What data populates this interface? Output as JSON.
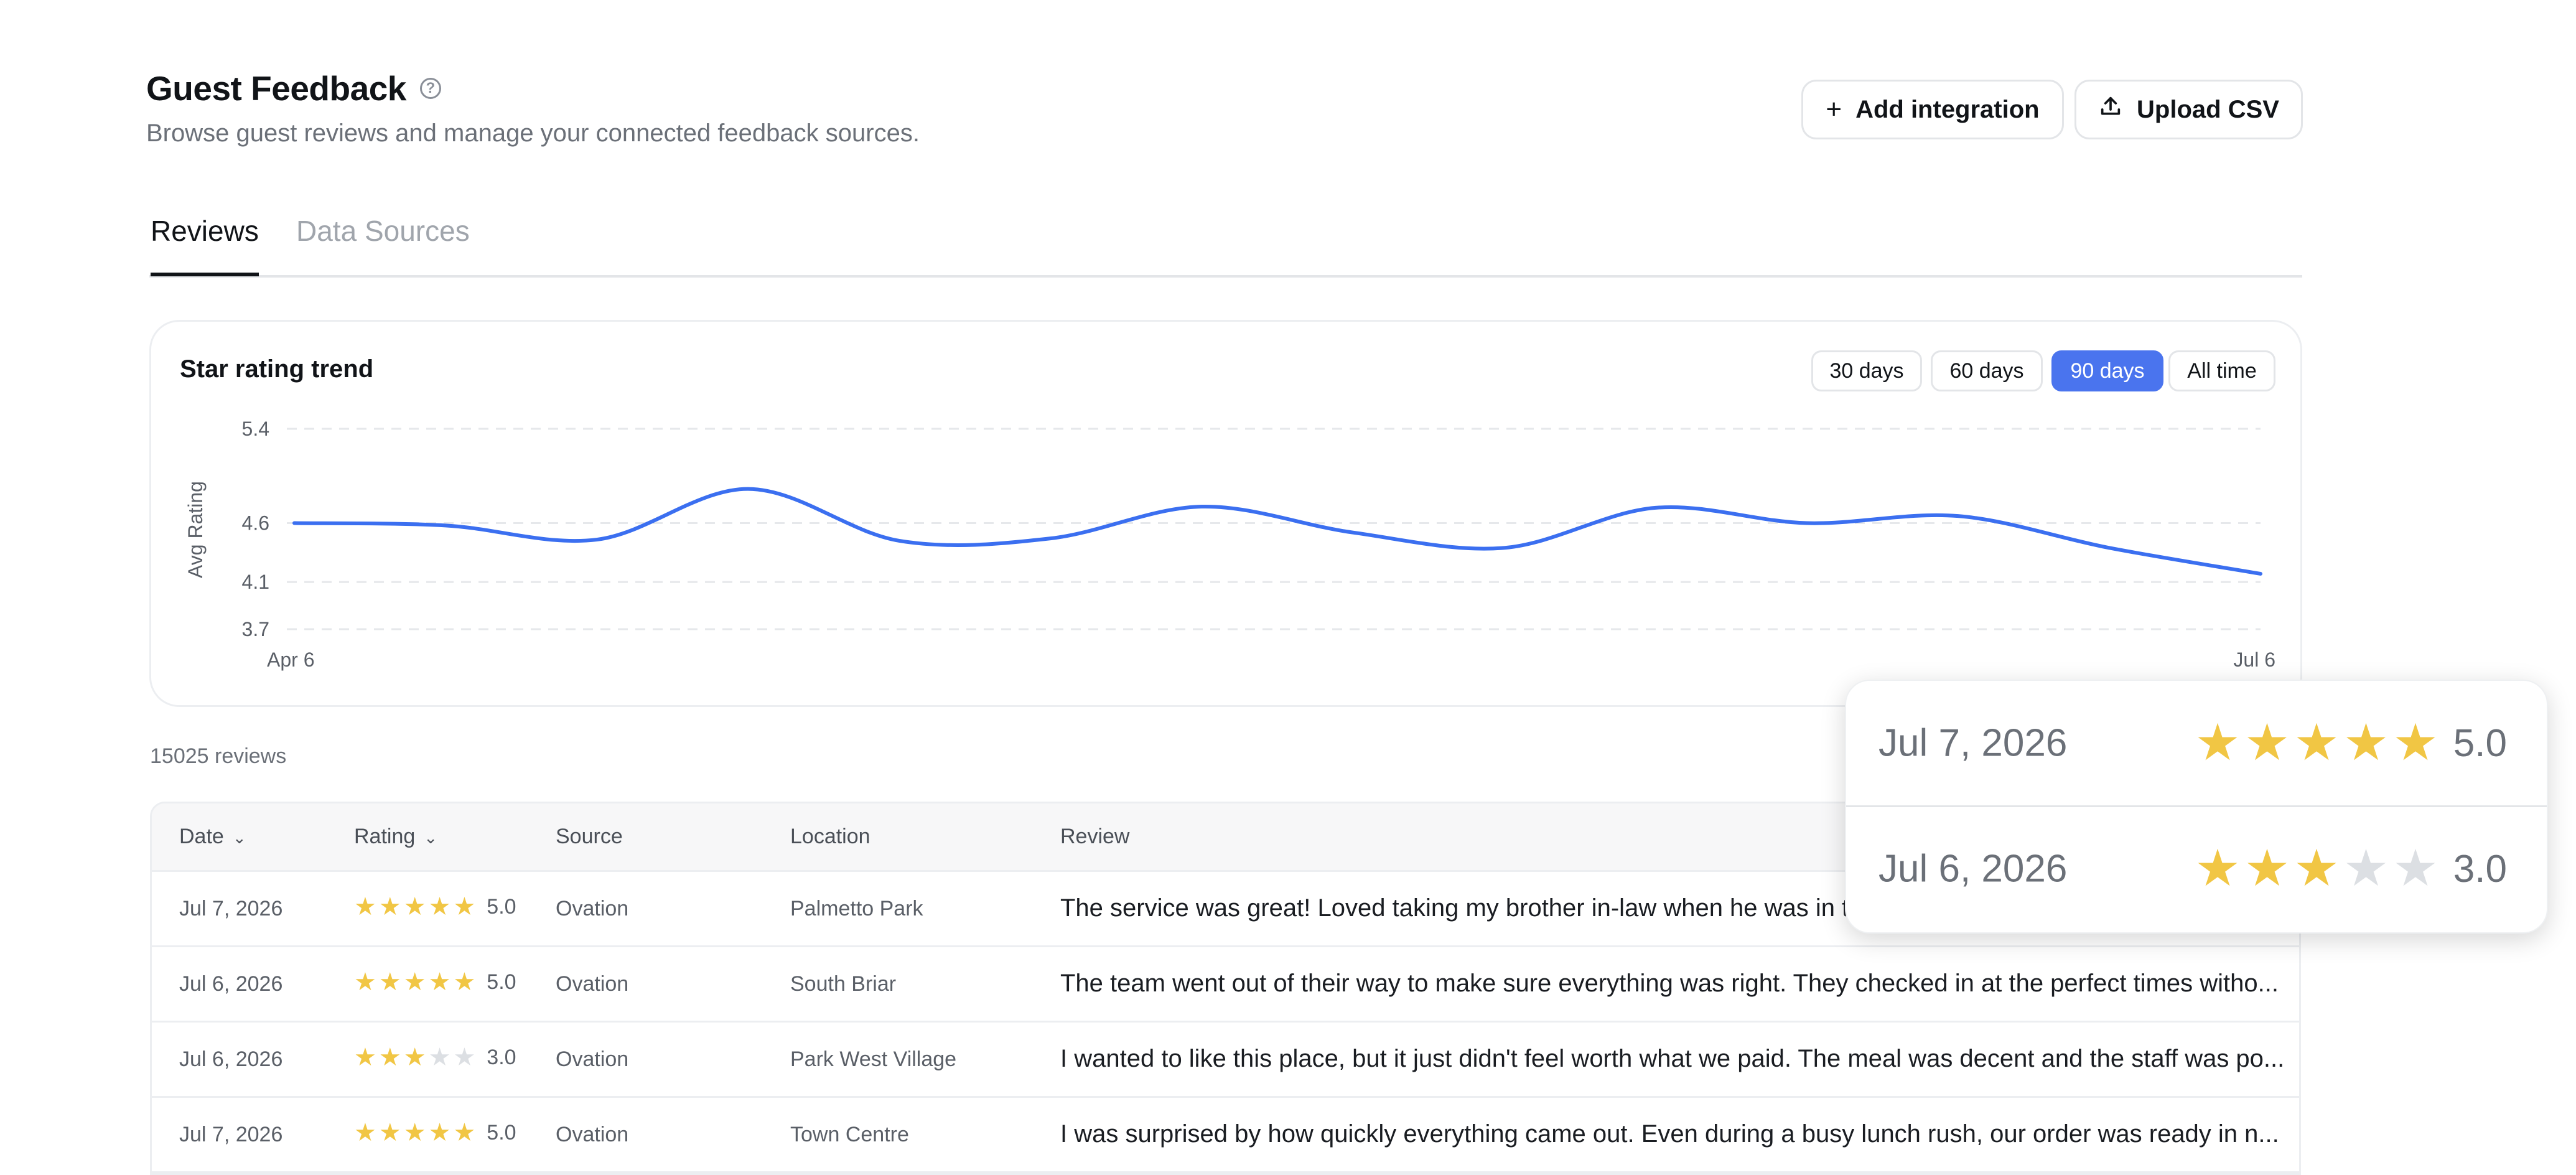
{
  "header": {
    "title": "Guest Feedback",
    "help_icon": "question-circle-icon",
    "subtitle": "Browse guest reviews and manage your connected feedback sources.",
    "add_integration_label": "Add integration",
    "upload_csv_label": "Upload CSV"
  },
  "tabs": [
    {
      "label": "Reviews",
      "active": true
    },
    {
      "label": "Data Sources",
      "active": false
    }
  ],
  "trend_card": {
    "title": "Star rating trend",
    "ranges": [
      {
        "label": "30 days",
        "active": false
      },
      {
        "label": "60 days",
        "active": false
      },
      {
        "label": "90 days",
        "active": true
      },
      {
        "label": "All time",
        "active": false
      }
    ]
  },
  "chart_data": {
    "type": "line",
    "title": "Star rating trend",
    "ylabel": "Avg Rating",
    "xlabel": "",
    "ylim": [
      3.7,
      5.4
    ],
    "yticks": [
      "5.4",
      "4.6",
      "4.1",
      "3.7"
    ],
    "xticks": [
      "Apr 6",
      "Jul 6"
    ],
    "grid": true,
    "series": [
      {
        "color": "#3b6ff0",
        "x": [
          "2026-04-06",
          "2026-04-13",
          "2026-04-20",
          "2026-04-27",
          "2026-05-04",
          "2026-05-11",
          "2026-05-18",
          "2026-05-25",
          "2026-06-01",
          "2026-06-08",
          "2026-06-15",
          "2026-06-22",
          "2026-06-29",
          "2026-07-06"
        ],
        "values": [
          4.6,
          4.58,
          4.46,
          4.89,
          4.45,
          4.47,
          4.74,
          4.52,
          4.39,
          4.73,
          4.6,
          4.66,
          4.39,
          4.17
        ]
      }
    ]
  },
  "reviews": {
    "count_label": "15025 reviews",
    "columns": {
      "date": "Date",
      "rating": "Rating",
      "source": "Source",
      "location": "Location",
      "review": "Review"
    },
    "rows": [
      {
        "date": "Jul 7, 2026",
        "stars": 5,
        "rating": "5.0",
        "source": "Ovation",
        "location": "Palmetto Park",
        "review": "The service was great! Loved taking my brother in-law when he was in t"
      },
      {
        "date": "Jul 6, 2026",
        "stars": 5,
        "rating": "5.0",
        "source": "Ovation",
        "location": "South Briar",
        "review": "The team went out of their way to make sure everything was right. They checked in at the perfect times witho..."
      },
      {
        "date": "Jul 6, 2026",
        "stars": 3,
        "rating": "3.0",
        "source": "Ovation",
        "location": "Park West Village",
        "review": "I wanted to like this place, but it just didn't feel worth what we paid. The meal was decent and the staff was po..."
      },
      {
        "date": "Jul 7, 2026",
        "stars": 5,
        "rating": "5.0",
        "source": "Ovation",
        "location": "Town Centre",
        "review": "I was surprised by how quickly everything came out. Even during a busy lunch rush, our order was ready in n..."
      }
    ]
  },
  "popup": {
    "rows": [
      {
        "date": "Jul 7, 2026",
        "stars": 5,
        "rating": "5.0"
      },
      {
        "date": "Jul 6, 2026",
        "stars": 3,
        "rating": "3.0"
      }
    ]
  },
  "colors": {
    "accent": "#4a74ee",
    "star_on": "#f1c644",
    "star_off": "#dcdfe3",
    "line": "#3b6ff0"
  }
}
